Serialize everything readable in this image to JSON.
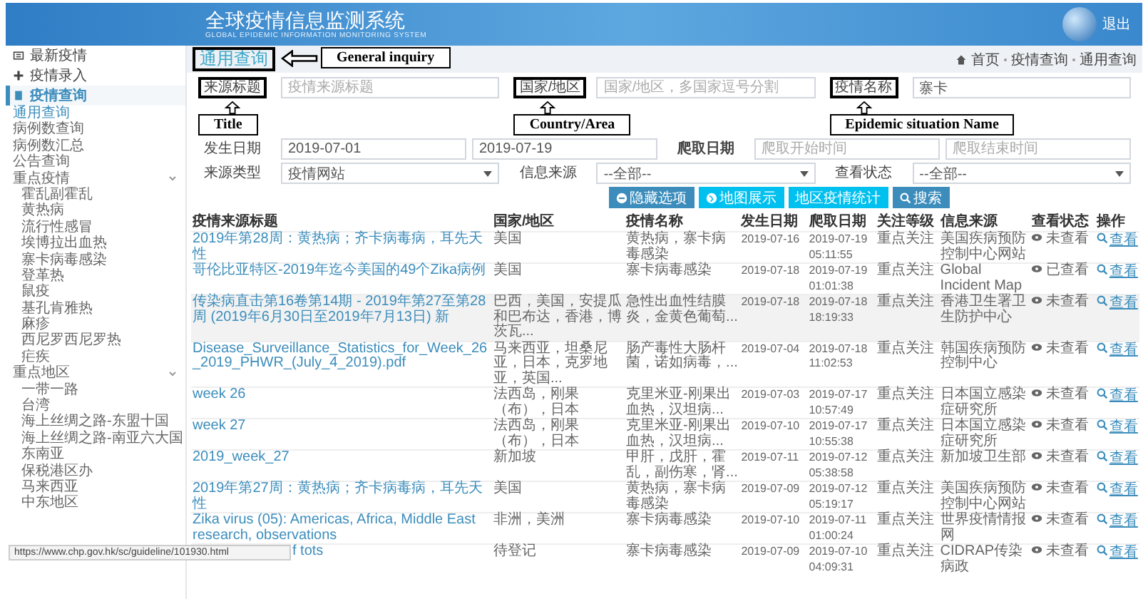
{
  "header": {
    "title": "全球疫情信息监测系统",
    "subtitle": "GLOBAL EPIDEMIC INFORMATION MONITORING SYSTEM",
    "logout": "退出"
  },
  "sidebar": [
    {
      "label": "最新疫情",
      "kind": "latest",
      "selected": false
    },
    {
      "label": "疫情录入",
      "kind": "entry",
      "selected": false
    },
    {
      "label": "疫情查询",
      "kind": "query",
      "selected": true,
      "expanded": true,
      "children": [
        {
          "label": "通用查询",
          "selected": true
        },
        {
          "label": "病例数查询",
          "selected": false
        },
        {
          "label": "病例数汇总",
          "selected": false
        },
        {
          "label": "公告查询",
          "selected": false
        },
        {
          "label": "重点疫情",
          "selected": false,
          "expanded": true,
          "children": [
            {
              "label": "霍乱副霍乱"
            },
            {
              "label": "黄热病"
            },
            {
              "label": "流行性感冒"
            },
            {
              "label": "埃博拉出血热"
            },
            {
              "label": "寨卡病毒感染"
            },
            {
              "label": "登革热"
            },
            {
              "label": "鼠疫"
            },
            {
              "label": "基孔肯雅热"
            },
            {
              "label": "麻疹"
            },
            {
              "label": "西尼罗西尼罗热"
            },
            {
              "label": "疟疾"
            }
          ]
        },
        {
          "label": "重点地区",
          "selected": false,
          "expanded": true,
          "children": [
            {
              "label": "一带一路"
            },
            {
              "label": "台湾"
            },
            {
              "label": "海上丝绸之路-东盟十国"
            },
            {
              "label": "海上丝绸之路-南亚六大国"
            },
            {
              "label": "东南亚"
            },
            {
              "label": "保税港区办"
            },
            {
              "label": "马来西亚"
            },
            {
              "label": "中东地区"
            }
          ]
        }
      ]
    }
  ],
  "page_title": {
    "text": "通用查询",
    "highlighted": true,
    "annotation": "General inquiry"
  },
  "breadcrumb": [
    "首页",
    "疫情查询",
    "通用查询"
  ],
  "form": {
    "rows": [
      [
        {
          "label": "来源标题",
          "bold": false,
          "highlighted": true,
          "annotation": "Title",
          "inputs": [
            {
              "kind": "input",
              "placeholder": "疫情来源标题"
            }
          ]
        },
        {
          "label": "国家/地区",
          "bold": false,
          "highlighted": true,
          "annotation": "Country/Area",
          "inputs": [
            {
              "kind": "input",
              "placeholder": "国家/地区，多国家逗号分割"
            }
          ]
        },
        {
          "label": "疫情名称",
          "bold": false,
          "highlighted": true,
          "annotation": "Epidemic situation Name",
          "inputs": [
            {
              "kind": "input",
              "value": "寨卡"
            }
          ]
        }
      ],
      [
        {
          "label": "发生日期",
          "bold": false,
          "highlighted": false,
          "inputs": [
            {
              "kind": "input",
              "value": "2019-07-01"
            },
            {
              "kind": "input",
              "value": "2019-07-19"
            }
          ]
        },
        {
          "label": "爬取日期",
          "bold": true,
          "highlighted": false,
          "inputs": [
            {
              "kind": "input",
              "placeholder": "爬取开始时间"
            },
            {
              "kind": "input",
              "placeholder": "爬取结束时间"
            }
          ]
        }
      ],
      [
        {
          "label": "来源类型",
          "bold": false,
          "highlighted": false,
          "inputs": [
            {
              "kind": "select",
              "value": "疫情网站"
            }
          ]
        },
        {
          "label": "信息来源",
          "bold": false,
          "highlighted": false,
          "inputs": [
            {
              "kind": "select",
              "value": "--全部--"
            }
          ]
        },
        {
          "label": "查看状态",
          "bold": false,
          "highlighted": false,
          "inputs": [
            {
              "kind": "select",
              "value": "--全部--"
            }
          ]
        }
      ]
    ],
    "buttons": [
      {
        "label": "隐藏选项",
        "kind": "toggle"
      },
      {
        "label": "地图展示",
        "kind": "map"
      },
      {
        "label": "地区疫情统计",
        "kind": "stats"
      },
      {
        "label": "搜索",
        "kind": "search"
      }
    ]
  },
  "table": {
    "columns": [
      "疫情来源标题",
      "国家/地区",
      "疫情名称",
      "发生日期",
      "爬取日期",
      "关注等级",
      "信息来源",
      "查看状态",
      "操作"
    ],
    "rows": [
      {
        "title": "2019年第28周：黄热病；齐卡病毒病，耳先天性",
        "partial": false,
        "highlighted": false,
        "country": "美国",
        "disease": "黄热病，寨卡病毒感染",
        "date": "2019-07-16",
        "crawled": "2019-07-19 05:11:55",
        "level": "重点关注",
        "source": "美国疾病预防控制中心网站",
        "status": "未查看",
        "action": "查看"
      },
      {
        "title": "哥伦比亚特区-2019年迄今美国的49个Zika病例",
        "partial": false,
        "highlighted": false,
        "country": "美国",
        "disease": "寨卡病毒感染",
        "date": "2019-07-18",
        "crawled": "2019-07-19 01:01:38",
        "level": "重点关注",
        "source": "Global Incident Map",
        "status": "已查看",
        "action": "查看"
      },
      {
        "title": "传染病直击第16卷第14期 - 2019年第27至第28周 (2019年6月30日至2019年7月13日) 新",
        "partial": false,
        "highlighted": true,
        "country": "巴西，美国，安提瓜和巴布达，香港，博茨瓦...",
        "disease": "急性出血性结膜炎，金黄色葡萄...",
        "date": "2019-07-18",
        "crawled": "2019-07-18 18:19:33",
        "level": "重点关注",
        "source": "香港卫生署卫生防护中心",
        "status": "未查看",
        "action": "查看"
      },
      {
        "title": "Disease_Surveillance_Statistics_for_Week_26_2019_PHWR_(July_4_2019).pdf",
        "partial": false,
        "highlighted": false,
        "country": "马来西亚，坦桑尼亚，日本，克罗地亚，英国...",
        "disease": "肠产毒性大肠杆菌，诺如病毒，...",
        "date": "2019-07-04",
        "crawled": "2019-07-18 11:02:53",
        "level": "重点关注",
        "source": "韩国疾病预防控制中心",
        "status": "未查看",
        "action": "查看"
      },
      {
        "title": "week 26",
        "partial": false,
        "highlighted": false,
        "country": "法西岛，刚果（布），日本",
        "disease": "克里米亚-刚果出血热，汉坦病...",
        "date": "2019-07-03",
        "crawled": "2019-07-17 10:57:49",
        "level": "重点关注",
        "source": "日本国立感染症研究所",
        "status": "未查看",
        "action": "查看"
      },
      {
        "title": "week 27",
        "partial": false,
        "highlighted": false,
        "country": "法西岛，刚果（布），日本",
        "disease": "克里米亚-刚果出血热，汉坦病...",
        "date": "2019-07-10",
        "crawled": "2019-07-17 10:55:38",
        "level": "重点关注",
        "source": "日本国立感染症研究所",
        "status": "未查看",
        "action": "查看"
      },
      {
        "title": "2019_week_27",
        "partial": false,
        "highlighted": false,
        "country": "新加坡",
        "disease": "甲肝，戊肝，霍乱，副伤寒，肾...",
        "date": "2019-07-11",
        "crawled": "2019-07-12 05:38:58",
        "level": "重点关注",
        "source": "新加坡卫生部",
        "status": "未查看",
        "action": "查看"
      },
      {
        "title": "2019年第27周：黄热病；齐卡病毒病，耳先天性",
        "partial": false,
        "highlighted": false,
        "country": "美国",
        "disease": "黄热病，寨卡病毒感染",
        "date": "2019-07-09",
        "crawled": "2019-07-12 05:19:17",
        "level": "重点关注",
        "source": "美国疾病预防控制中心网站",
        "status": "未查看",
        "action": "查看"
      },
      {
        "title": "Zika virus (05): Americas, Africa, Middle East research, observations",
        "partial": false,
        "highlighted": false,
        "country": "非洲，美洲",
        "disease": "寨卡病毒感染",
        "date": "2019-07-10",
        "crawled": "2019-07-11 01:00:24",
        "level": "重点关注",
        "source": "世界疫情情报网",
        "status": "未查看",
        "action": "查看"
      },
      {
        "title": "f tots",
        "partial": true,
        "highlighted": false,
        "country": "待登记",
        "disease": "寨卡病毒感染",
        "date": "2019-07-09",
        "crawled": "2019-07-10 04:09:31",
        "level": "重点关注",
        "source": "CIDRAP传染病政",
        "status": "未查看",
        "action": "查看"
      }
    ]
  },
  "status_url": "https://www.chp.gov.hk/sc/guideline/101930.html"
}
